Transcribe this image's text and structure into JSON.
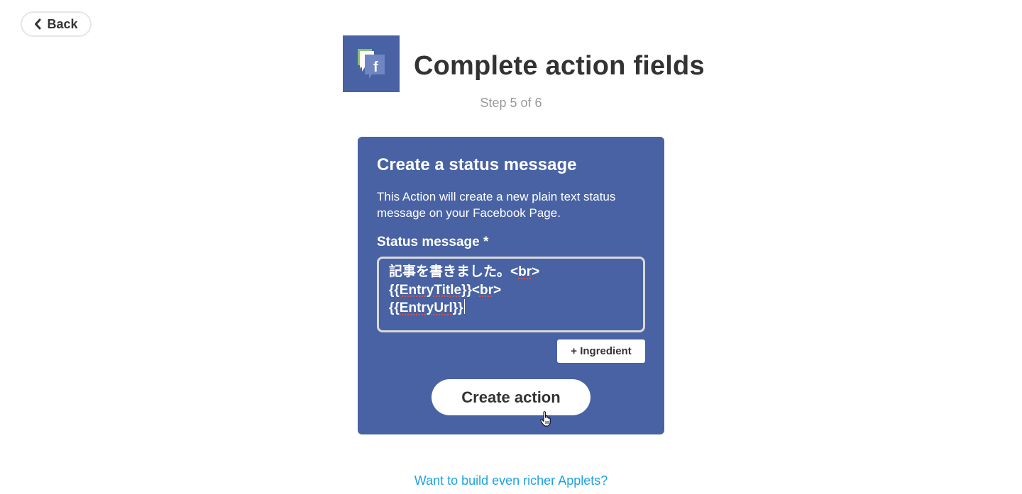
{
  "nav": {
    "back_label": "Back",
    "back_icon": "chevron-left-icon"
  },
  "header": {
    "service_icon": "facebook-pages-icon",
    "title": "Complete action fields",
    "step": "Step 5 of 6"
  },
  "action_card": {
    "title": "Create a status message",
    "description": "This Action will create a new plain text status message on your Facebook Page.",
    "field": {
      "label": "Status message *",
      "value_lines": [
        {
          "pre": "記事を書きました。<",
          "flag": "br",
          "post": ">"
        },
        {
          "pre": "{{",
          "flag": "EntryTitle",
          "post": "}}<br>",
          "flag2": "br"
        },
        {
          "pre": "{{",
          "flag": "EntryUrl",
          "post": "}}"
        }
      ]
    },
    "ingredient_button": "+ Ingredient",
    "submit_button": "Create action",
    "color": "#4862a3"
  },
  "footer": {
    "upsell_link": "Want to build even richer Applets?",
    "link_color": "#1ea1e0"
  }
}
